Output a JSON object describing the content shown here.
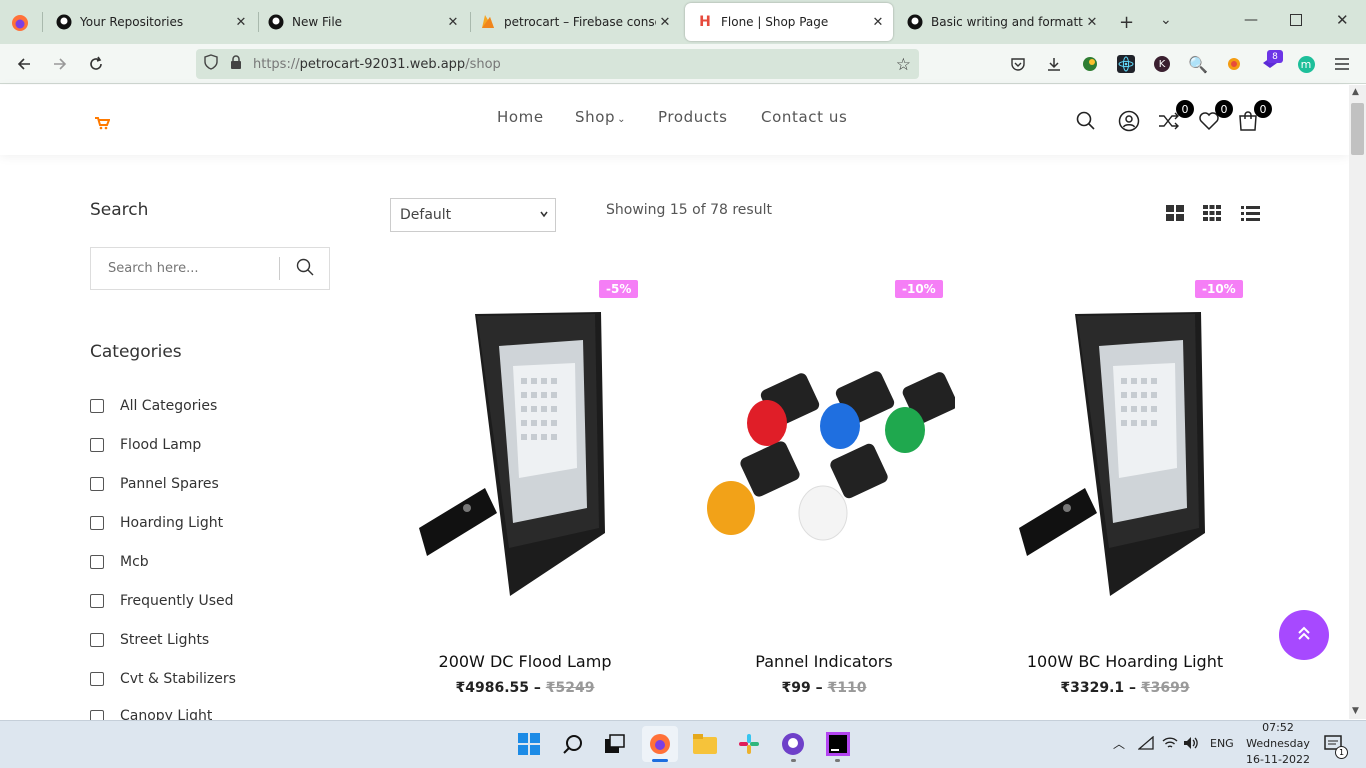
{
  "browser": {
    "tabs": [
      {
        "title": "Your Repositories",
        "icon": "github-icon"
      },
      {
        "title": "New File",
        "icon": "github-icon"
      },
      {
        "title": "petrocart – Firebase console",
        "icon": "firebase-icon"
      },
      {
        "title": "Flone | Shop Page",
        "icon": "flone-icon",
        "active": true
      },
      {
        "title": "Basic writing and formatting",
        "icon": "github-icon"
      }
    ],
    "url": {
      "scheme": "https://",
      "host": "petrocart-92031.web.app",
      "path": "/shop"
    },
    "extension_badge": "8"
  },
  "site": {
    "nav": [
      "Home",
      "Shop",
      "Products",
      "Contact us"
    ],
    "counts": {
      "compare": "0",
      "wishlist": "0",
      "cart": "0"
    }
  },
  "sidebar": {
    "search_title": "Search",
    "search_placeholder": "Search here...",
    "categories_title": "Categories",
    "categories": [
      "All Categories",
      "Flood Lamp",
      "Pannel Spares",
      "Hoarding Light",
      "Mcb",
      "Frequently Used",
      "Street Lights",
      "Cvt & Stabilizers",
      "Canopy Light"
    ]
  },
  "toolbar": {
    "sort_selected": "Default",
    "result_text": "Showing 15 of 78 result"
  },
  "products": [
    {
      "name": "200W DC Flood Lamp",
      "price": "₹4986.55",
      "old_price": "₹5249",
      "discount": "-5%"
    },
    {
      "name": "Pannel Indicators",
      "price": "₹99",
      "old_price": "₹110",
      "discount": "-10%"
    },
    {
      "name": "100W BC Hoarding Light",
      "price": "₹3329.1",
      "old_price": "₹3699",
      "discount": "-10%"
    }
  ],
  "taskbar": {
    "lang": "ENG",
    "time": "07:52",
    "day": "Wednesday",
    "date": "16-11-2022",
    "notif": "1"
  },
  "colors": {
    "accent": "#a749ff",
    "discount": "#f57ef6",
    "tabbar": "#d7e5da"
  }
}
